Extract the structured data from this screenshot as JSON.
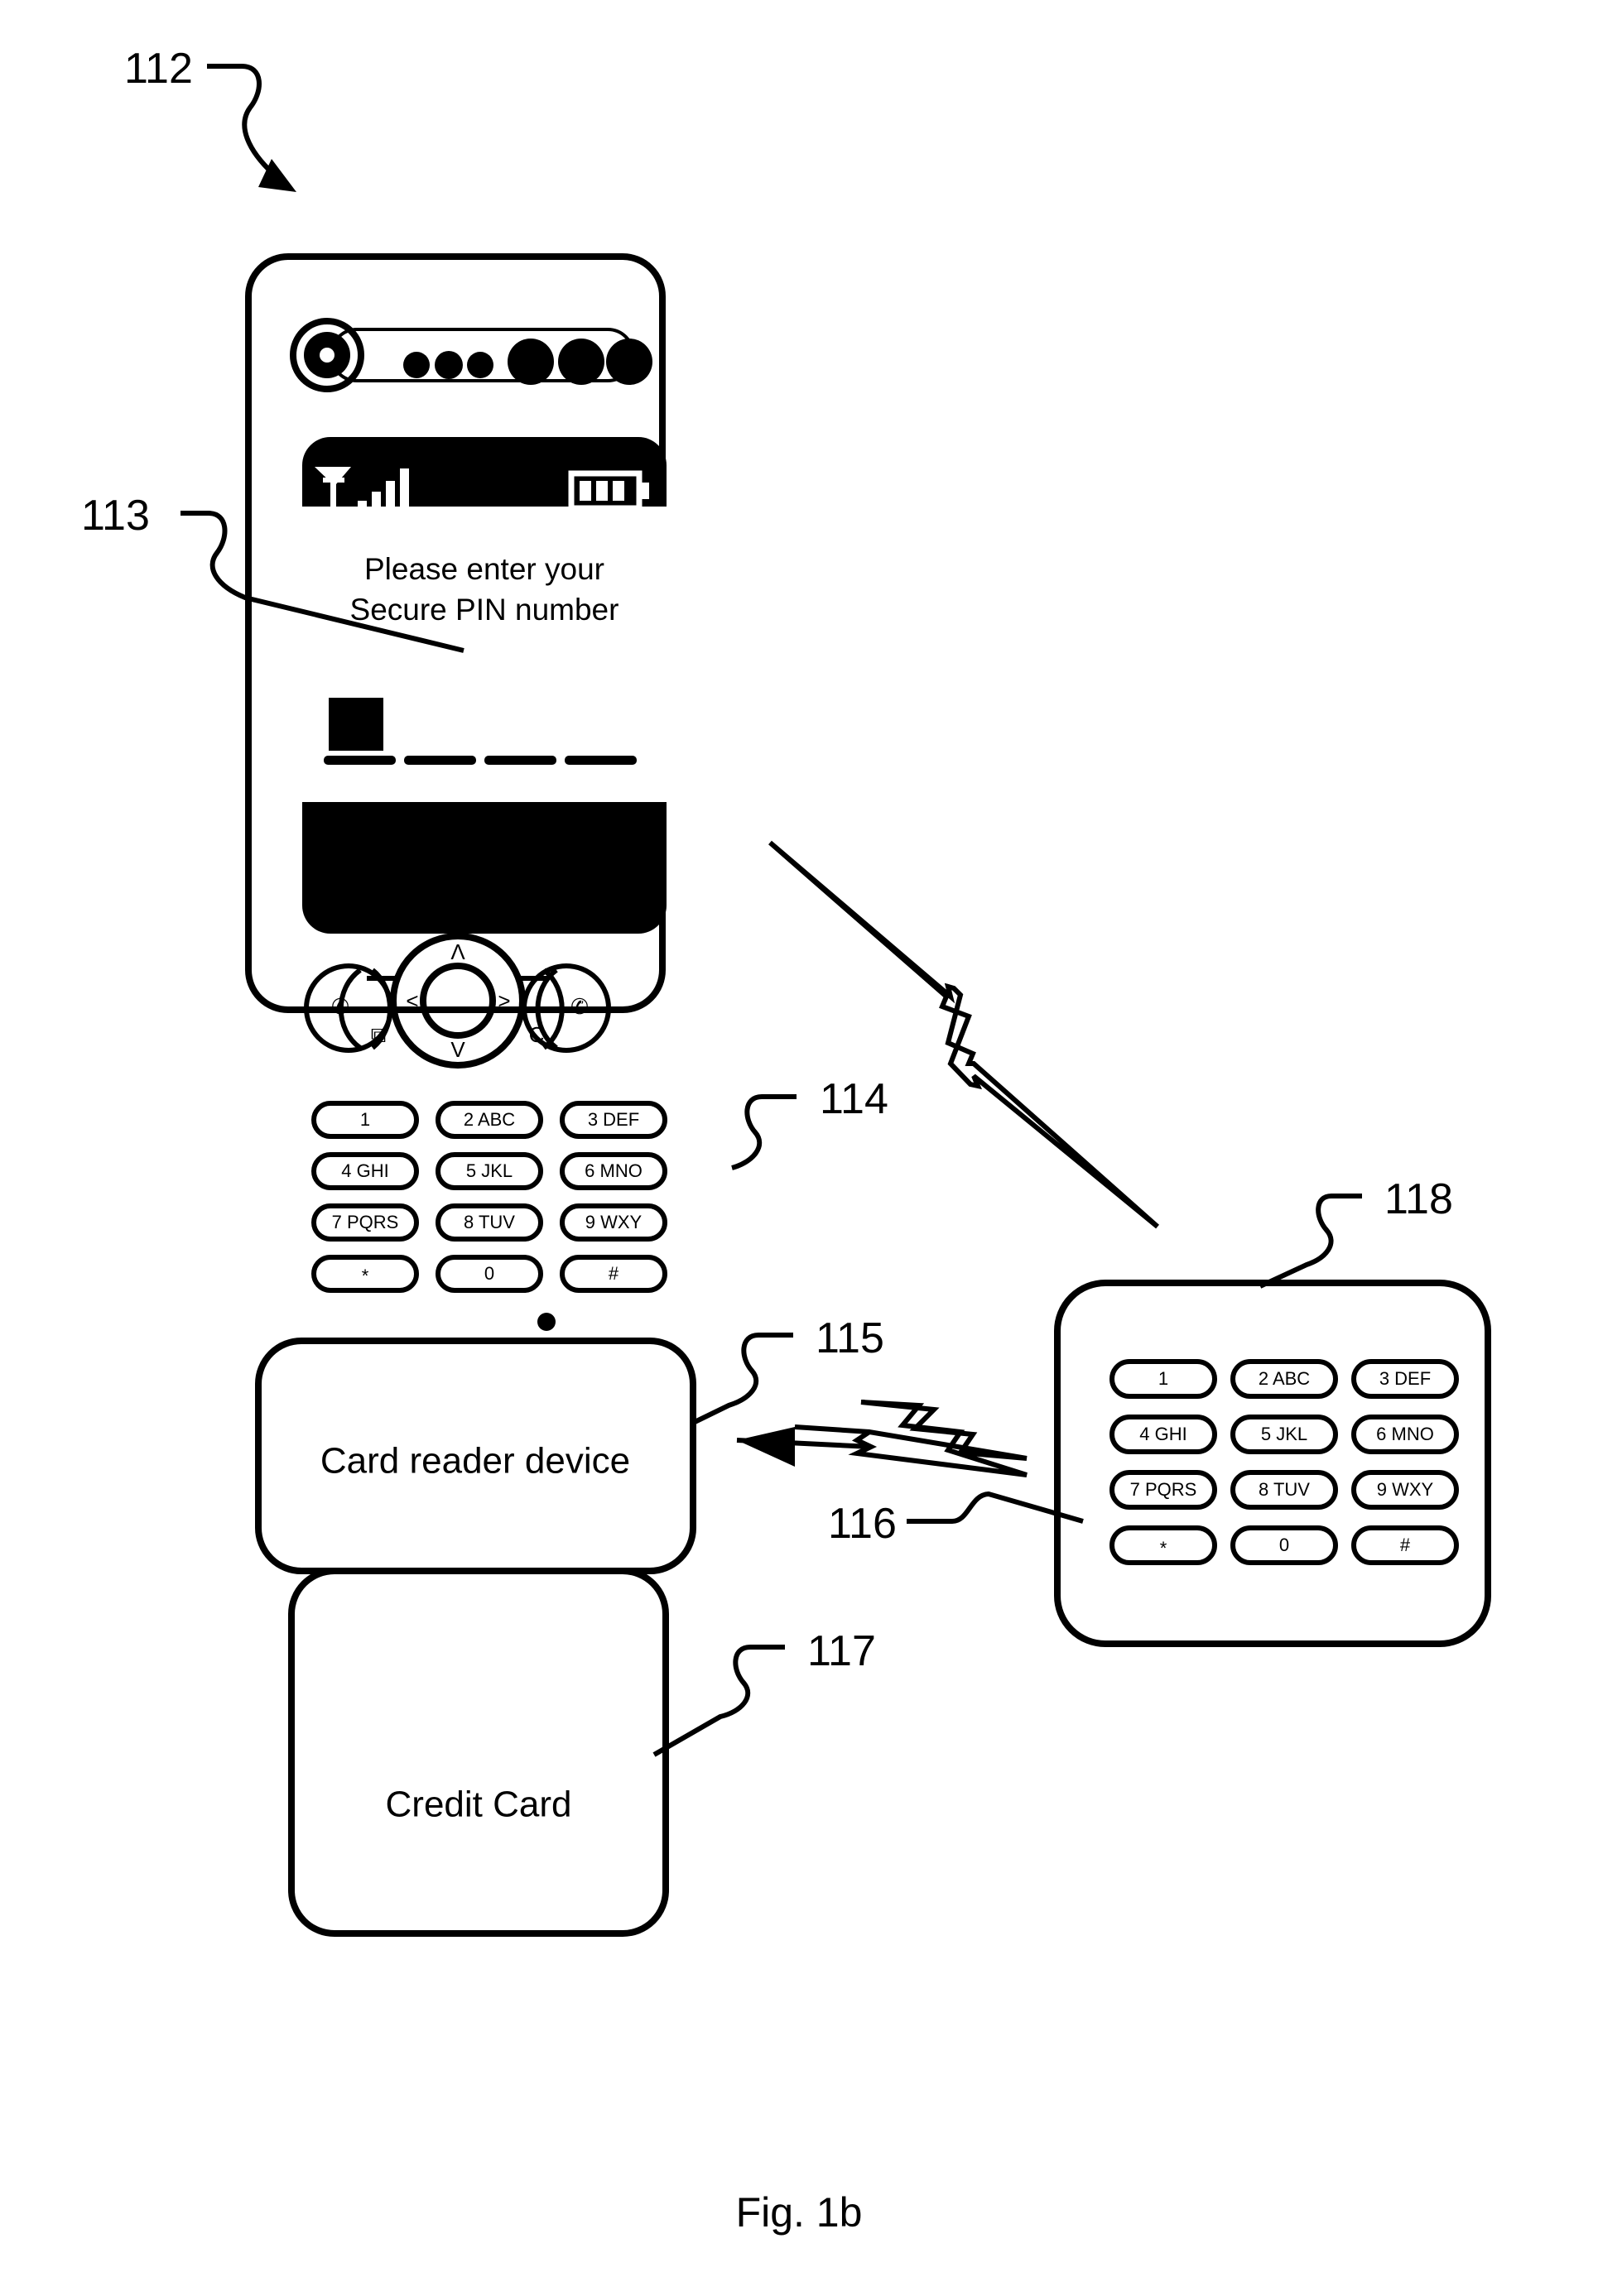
{
  "figure": {
    "caption": "Fig. 1b",
    "type": "patent-diagram"
  },
  "reference_numerals": [
    {
      "id": "112",
      "label": "112",
      "target": "mobile-phone"
    },
    {
      "id": "113",
      "label": "113",
      "target": "phone-display-prompt"
    },
    {
      "id": "114",
      "label": "114",
      "target": "wireless-link-phone-keypad"
    },
    {
      "id": "115",
      "label": "115",
      "target": "card-reader-device"
    },
    {
      "id": "116",
      "label": "116",
      "target": "credit-card"
    },
    {
      "id": "117",
      "label": "117",
      "target": "external-keypad-keys"
    },
    {
      "id": "118",
      "label": "118",
      "target": "external-keypad-device"
    }
  ],
  "phone": {
    "status_bar": {
      "antenna_icon": "antenna-icon",
      "signal_icon": "signal-bars-icon",
      "signal_bars": 4,
      "battery_icon": "battery-icon",
      "battery_segments": 3
    },
    "display": {
      "prompt_line1": "Please enter your",
      "prompt_line2": "Secure PIN number",
      "cursor": "cursor-block",
      "pin_field_slots": 4
    },
    "softkeys": [
      {
        "name": "call-key",
        "glyph": "✆"
      },
      {
        "name": "menu-key",
        "glyph": "⧉"
      },
      {
        "name": "end-call-key",
        "glyph": "✆"
      },
      {
        "name": "clear-key",
        "glyph": "C"
      }
    ],
    "navigation": {
      "up": "Λ",
      "down": "V",
      "left": "<",
      "right": ">",
      "center": "select-button"
    },
    "keypad": [
      {
        "key": "1",
        "label": "1"
      },
      {
        "key": "2",
        "label": "2 ABC"
      },
      {
        "key": "3",
        "label": "3 DEF"
      },
      {
        "key": "4",
        "label": "4 GHI"
      },
      {
        "key": "5",
        "label": "5 JKL"
      },
      {
        "key": "6",
        "label": "6 MNO"
      },
      {
        "key": "7",
        "label": "7 PQRS"
      },
      {
        "key": "8",
        "label": "8 TUV"
      },
      {
        "key": "9",
        "label": "9 WXY"
      },
      {
        "key": "star",
        "label": "*"
      },
      {
        "key": "0",
        "label": "0"
      },
      {
        "key": "hash",
        "label": "#"
      }
    ]
  },
  "card_reader": {
    "label": "Card reader device"
  },
  "credit_card": {
    "label": "Credit Card"
  },
  "external_keypad": {
    "keys": [
      {
        "key": "1",
        "label": "1"
      },
      {
        "key": "2",
        "label": "2 ABC"
      },
      {
        "key": "3",
        "label": "3 DEF"
      },
      {
        "key": "4",
        "label": "4 GHI"
      },
      {
        "key": "5",
        "label": "5 JKL"
      },
      {
        "key": "6",
        "label": "6 MNO"
      },
      {
        "key": "7",
        "label": "7 PQRS"
      },
      {
        "key": "8",
        "label": "8 TUV"
      },
      {
        "key": "9",
        "label": "9 WXY"
      },
      {
        "key": "star",
        "label": "*"
      },
      {
        "key": "0",
        "label": "0"
      },
      {
        "key": "hash",
        "label": "#"
      }
    ]
  },
  "links": [
    {
      "name": "wireless-link-phone-to-keypad",
      "style": "lightning-bolt"
    },
    {
      "name": "wireless-link-reader-to-keypad",
      "style": "lightning-bolt-arrow"
    }
  ],
  "colors": {
    "ink": "#000000",
    "paper": "#ffffff"
  }
}
